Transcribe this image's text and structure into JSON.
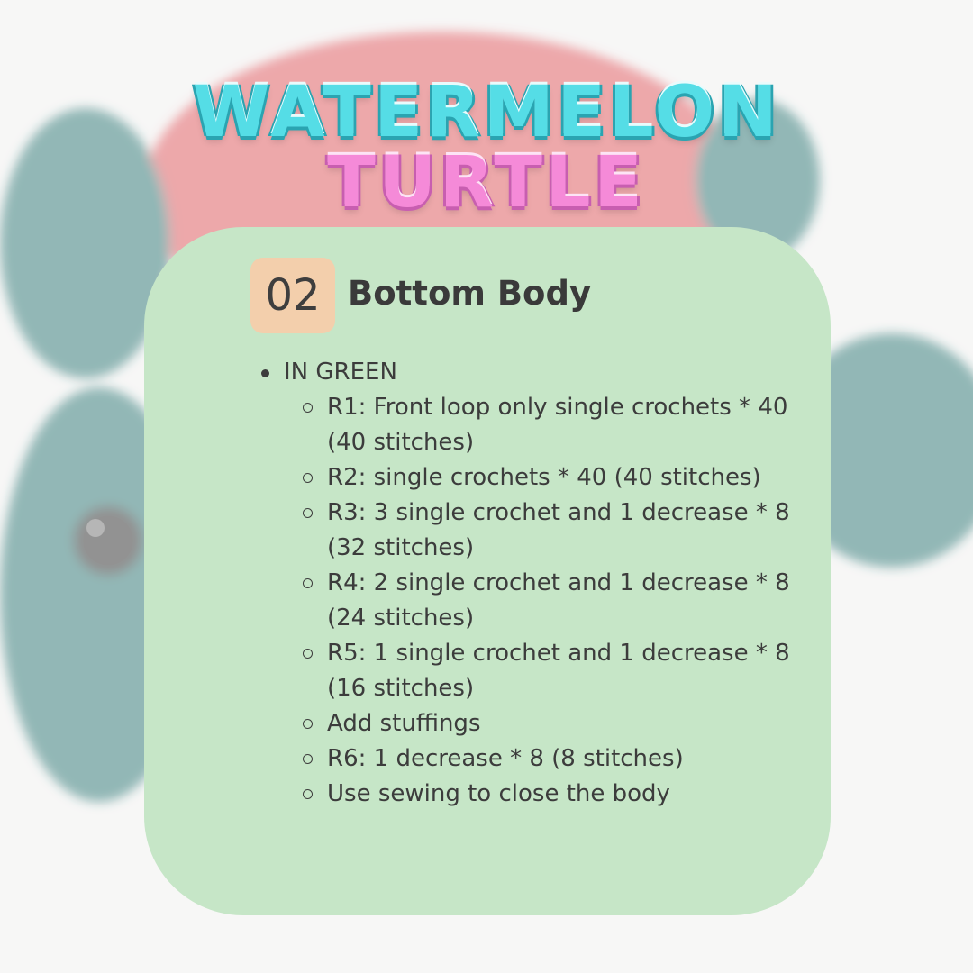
{
  "title": {
    "line1": "WATERMELON",
    "line2": "TURTLE"
  },
  "card": {
    "step_number": "02",
    "step_title": "Bottom Body",
    "section_label": "IN GREEN",
    "steps": [
      "R1: Front loop only single crochets * 40 (40 stitches)",
      "R2:  single crochets * 40 (40 stitches)",
      "R3: 3 single crochet and 1 decrease * 8 (32 stitches)",
      "R4: 2 single crochet and 1 decrease * 8 (24 stitches)",
      "R5: 1 single crochet and 1 decrease * 8 (16 stitches)",
      "Add stuffings",
      "R6: 1 decrease * 8 (8 stitches)",
      "Use sewing to close the body"
    ]
  },
  "colors": {
    "card_bg": "#c6e6c7",
    "badge_bg": "#f3cfac",
    "title_cyan": "#55dde6",
    "title_pink": "#f58ad8",
    "text": "#3c3c3c"
  }
}
